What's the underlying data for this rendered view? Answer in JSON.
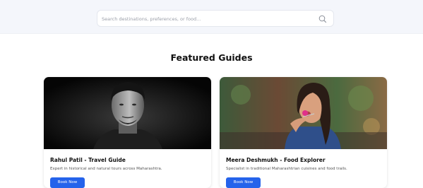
{
  "search": {
    "placeholder": "Search destinations, preferences, or food..."
  },
  "section": {
    "title": "Featured Guides"
  },
  "guides": [
    {
      "name": "Rahul Patil - Travel Guide",
      "description": "Expert in historical and natural tours across Maharashtra.",
      "button_label": "Book Now"
    },
    {
      "name": "Meera Deshmukh - Food Explorer",
      "description": "Specialist in traditional Maharashtrian cuisines and food trails.",
      "button_label": "Book Now"
    }
  ],
  "colors": {
    "accent": "#2563eb",
    "band": "#f4f6fb"
  },
  "icons": {
    "search": "search-icon"
  }
}
